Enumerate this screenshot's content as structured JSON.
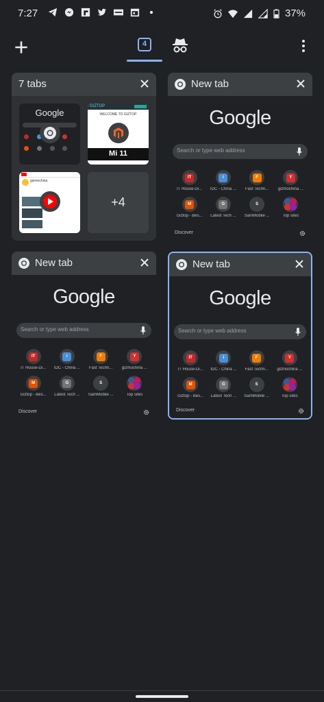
{
  "status_bar": {
    "time": "7:27",
    "battery": "37%",
    "left_icons": [
      "telegram-icon",
      "messenger-icon",
      "flipboard-icon",
      "twitter-icon",
      "gizmochina-icon",
      "calendar-icon",
      "dot-icon"
    ],
    "right_icons": [
      "alarm-icon",
      "wifi-icon",
      "signal-icon",
      "signal-icon",
      "battery-icon"
    ]
  },
  "toolbar": {
    "tab_count": "4",
    "accent": "#8ab4f8"
  },
  "group_card": {
    "title": "7 tabs",
    "more_count": "+4",
    "mini_site_1": "Google",
    "mini_site_2_title": "GIZTOP",
    "mini_site_2_banner": "WELCOME TO GIZTOP",
    "mini_site_2_caption": "Mi 11",
    "mini_site_3_title": "gizmochina"
  },
  "tabs": [
    {
      "title": "New tab"
    },
    {
      "title": "New tab"
    },
    {
      "title": "New tab"
    }
  ],
  "ntp": {
    "logo": "Google",
    "search_placeholder": "Search or type web address",
    "discover": "Discover",
    "shortcuts": [
      {
        "label": "IT House-Di...",
        "glyph": "IT",
        "bg": "#c62828"
      },
      {
        "label": "IDC - China ...",
        "glyph": "i",
        "bg": "#4a90d9"
      },
      {
        "label": "Fast Techn...",
        "glyph": "F",
        "bg": "#f57c00"
      },
      {
        "label": "gizmochina ...",
        "glyph": "Y",
        "bg": "#d32f2f"
      },
      {
        "label": "Giztop - Bes...",
        "glyph": "M",
        "bg": "#e65100"
      },
      {
        "label": "Latest Tech ...",
        "glyph": "G",
        "bg": "#757575"
      },
      {
        "label": "SamMobile ...",
        "glyph": "S",
        "bg": "#3c4043"
      },
      {
        "label": "Top sites",
        "glyph": "",
        "bg": "#3c4043"
      }
    ]
  }
}
